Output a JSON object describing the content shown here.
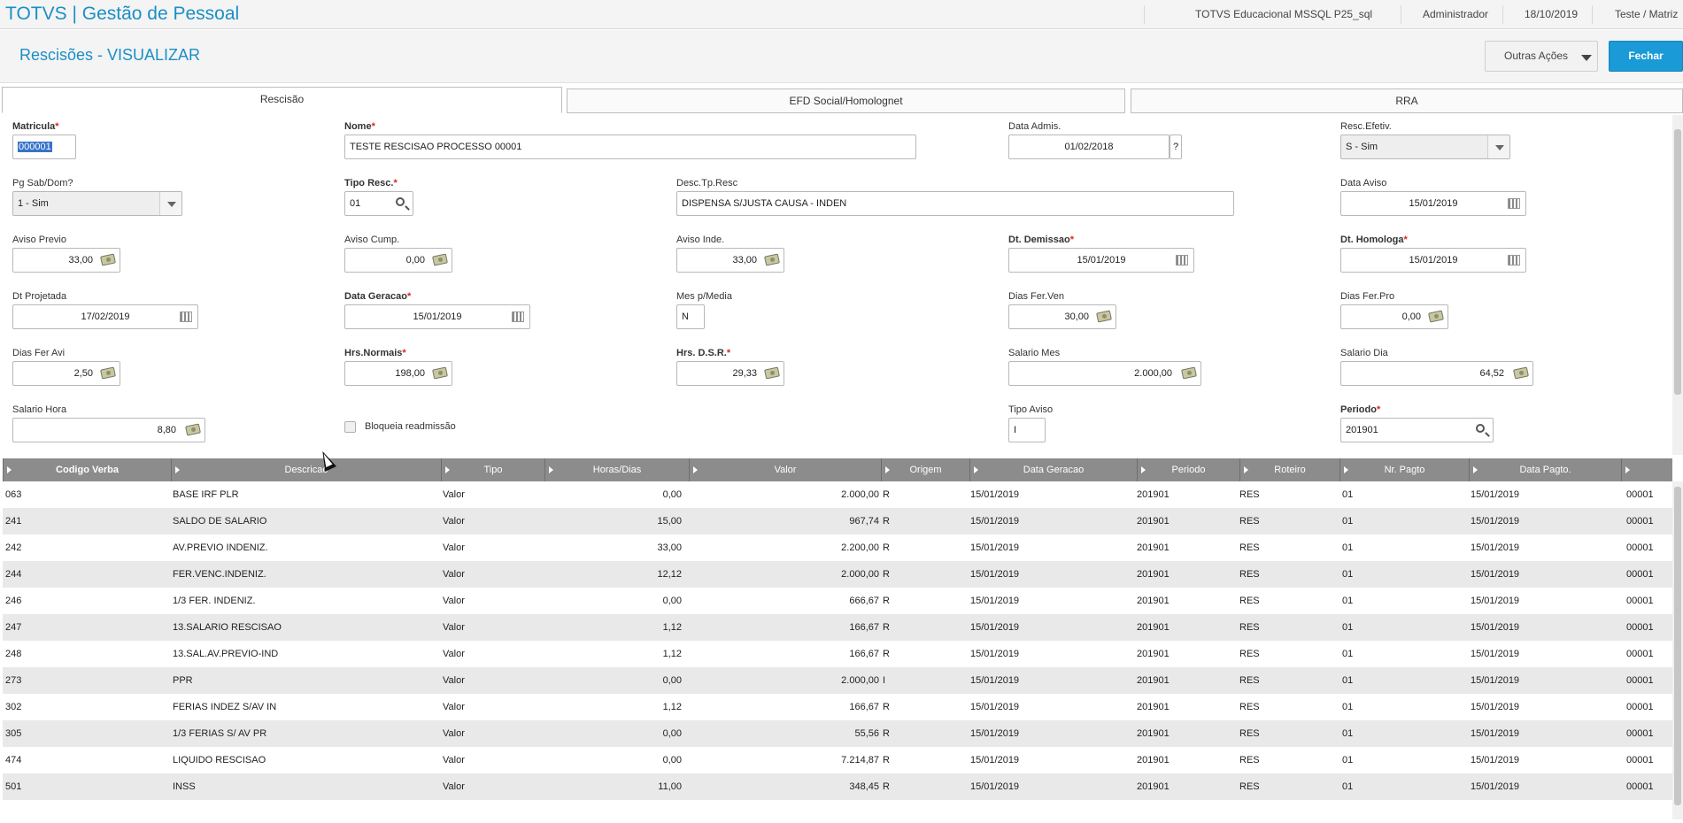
{
  "topbar": {
    "brand": "TOTVS | Gestão de Pessoal",
    "environment": "TOTVS Educacional MSSQL P25_sql",
    "user": "Administrador",
    "date": "18/10/2019",
    "branch": "Teste / Matriz"
  },
  "header": {
    "title": "Rescisões - VISUALIZAR",
    "outras_acoes": "Outras Ações",
    "fechar": "Fechar"
  },
  "tabs": [
    {
      "label": "Rescisão",
      "active": true
    },
    {
      "label": "EFD Social/Homolognet",
      "active": false
    },
    {
      "label": "RRA",
      "active": false
    }
  ],
  "form": {
    "matricula": {
      "label": "Matricula",
      "value": "000001"
    },
    "nome": {
      "label": "Nome",
      "value": "TESTE RESCISAO PROCESSO 00001"
    },
    "data_admis": {
      "label": "Data Admis.",
      "value": "01/02/2018",
      "help": "?"
    },
    "resc_efetiv": {
      "label": "Resc.Efetiv.",
      "value": "S - Sim"
    },
    "pg_sab_dom": {
      "label": "Pg Sab/Dom?",
      "value": "1 - Sim"
    },
    "tipo_resc": {
      "label": "Tipo Resc.",
      "value": "01"
    },
    "desc_tp_resc": {
      "label": "Desc.Tp.Resc",
      "value": "DISPENSA S/JUSTA CAUSA - INDEN"
    },
    "data_aviso": {
      "label": "Data Aviso",
      "value": "15/01/2019"
    },
    "aviso_previo": {
      "label": "Aviso Previo",
      "value": "33,00"
    },
    "aviso_cump": {
      "label": "Aviso Cump.",
      "value": "0,00"
    },
    "aviso_inde": {
      "label": "Aviso Inde.",
      "value": "33,00"
    },
    "dt_demissao": {
      "label": "Dt. Demissao",
      "value": "15/01/2019"
    },
    "dt_homologa": {
      "label": "Dt. Homologa",
      "value": "15/01/2019"
    },
    "dt_projetada": {
      "label": "Dt Projetada",
      "value": "17/02/2019"
    },
    "data_geracao": {
      "label": "Data Geracao",
      "value": "15/01/2019"
    },
    "mes_p_media": {
      "label": "Mes p/Media",
      "value": "N"
    },
    "dias_fer_ven": {
      "label": "Dias Fer.Ven",
      "value": "30,00"
    },
    "dias_fer_pro": {
      "label": "Dias Fer.Pro",
      "value": "0,00"
    },
    "dias_fer_avi": {
      "label": "Dias Fer Avi",
      "value": "2,50"
    },
    "hrs_normais": {
      "label": "Hrs.Normais",
      "value": "198,00"
    },
    "hrs_dsr": {
      "label": "Hrs. D.S.R.",
      "value": "29,33"
    },
    "salario_mes": {
      "label": "Salario Mes",
      "value": "2.000,00"
    },
    "salario_dia": {
      "label": "Salario Dia",
      "value": "64,52"
    },
    "salario_hora": {
      "label": "Salario Hora",
      "value": "8,80"
    },
    "bloqueia_readmissao": {
      "label": "Bloqueia readmissão",
      "checked": false
    },
    "tipo_aviso": {
      "label": "Tipo Aviso",
      "value": "I"
    },
    "periodo": {
      "label": "Periodo",
      "value": "201901"
    },
    "required_mark": "*"
  },
  "grid": {
    "columns": [
      "Codigo Verba",
      "Descricao",
      "Tipo",
      "Horas/Dias",
      "Valor",
      "Origem",
      "Data Geracao",
      "Periodo",
      "Roteiro",
      "Nr. Pagto",
      "Data Pagto.",
      ""
    ],
    "rows": [
      [
        "063",
        "BASE IRF PLR",
        "Valor",
        "0,00",
        "2.000,00",
        "R",
        "15/01/2019",
        "201901",
        "RES",
        "01",
        "15/01/2019",
        "00001"
      ],
      [
        "241",
        "SALDO DE SALARIO",
        "Valor",
        "15,00",
        "967,74",
        "R",
        "15/01/2019",
        "201901",
        "RES",
        "01",
        "15/01/2019",
        "00001"
      ],
      [
        "242",
        "AV.PREVIO INDENIZ.",
        "Valor",
        "33,00",
        "2.200,00",
        "R",
        "15/01/2019",
        "201901",
        "RES",
        "01",
        "15/01/2019",
        "00001"
      ],
      [
        "244",
        "FER.VENC.INDENIZ.",
        "Valor",
        "12,12",
        "2.000,00",
        "R",
        "15/01/2019",
        "201901",
        "RES",
        "01",
        "15/01/2019",
        "00001"
      ],
      [
        "246",
        "1/3 FER. INDENIZ.",
        "Valor",
        "0,00",
        "666,67",
        "R",
        "15/01/2019",
        "201901",
        "RES",
        "01",
        "15/01/2019",
        "00001"
      ],
      [
        "247",
        "13.SALARIO RESCISAO",
        "Valor",
        "1,12",
        "166,67",
        "R",
        "15/01/2019",
        "201901",
        "RES",
        "01",
        "15/01/2019",
        "00001"
      ],
      [
        "248",
        "13.SAL.AV.PREVIO-IND",
        "Valor",
        "1,12",
        "166,67",
        "R",
        "15/01/2019",
        "201901",
        "RES",
        "01",
        "15/01/2019",
        "00001"
      ],
      [
        "273",
        "PPR",
        "Valor",
        "0,00",
        "2.000,00",
        "I",
        "15/01/2019",
        "201901",
        "RES",
        "01",
        "15/01/2019",
        "00001"
      ],
      [
        "302",
        "FERIAS INDEZ S/AV IN",
        "Valor",
        "1,12",
        "166,67",
        "R",
        "15/01/2019",
        "201901",
        "RES",
        "01",
        "15/01/2019",
        "00001"
      ],
      [
        "305",
        "1/3 FERIAS S/ AV PR",
        "Valor",
        "0,00",
        "55,56",
        "R",
        "15/01/2019",
        "201901",
        "RES",
        "01",
        "15/01/2019",
        "00001"
      ],
      [
        "474",
        "LIQUIDO RESCISAO",
        "Valor",
        "0,00",
        "7.214,87",
        "R",
        "15/01/2019",
        "201901",
        "RES",
        "01",
        "15/01/2019",
        "00001"
      ],
      [
        "501",
        "INSS",
        "Valor",
        "11,00",
        "348,45",
        "R",
        "15/01/2019",
        "201901",
        "RES",
        "01",
        "15/01/2019",
        "00001"
      ]
    ]
  },
  "colors": {
    "brand": "#1a8fc6",
    "primary_button": "#1a9ad6",
    "grid_header": "#8c8c8c",
    "required": "#d9261c"
  }
}
